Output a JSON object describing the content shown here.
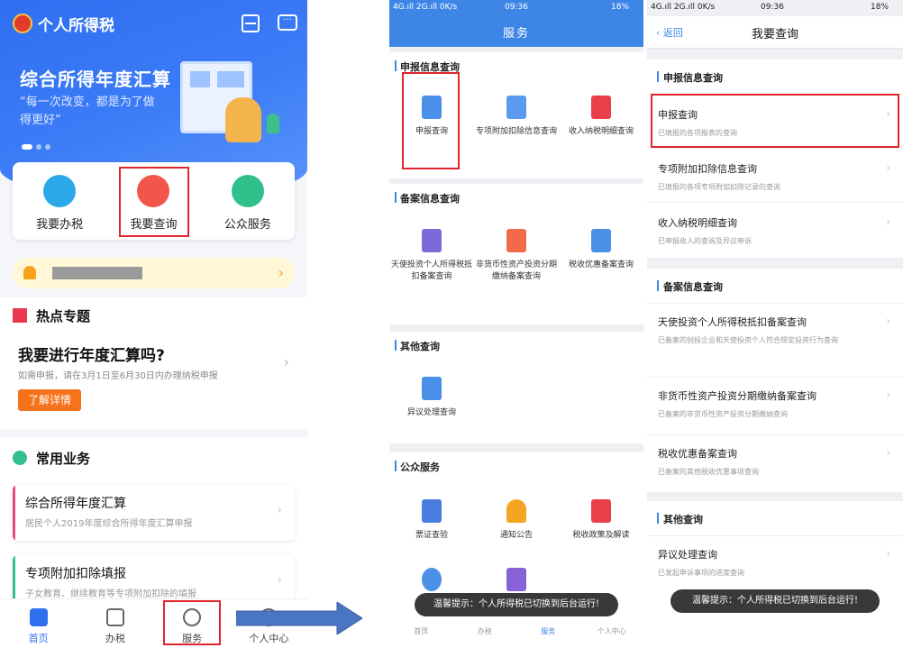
{
  "panel1": {
    "app_title": "个人所得税",
    "banner": {
      "title": "综合所得年度汇算",
      "subtitle": "“每一次改变，都是为了做得更好”"
    },
    "quick": [
      {
        "label": "我要办税",
        "color": "#2aa8e8"
      },
      {
        "label": "我要查询",
        "color": "#f2564a"
      },
      {
        "label": "公众服务",
        "color": "#2fc08c"
      }
    ],
    "hot": {
      "title": "热点专题",
      "headline": "我要进行年度汇算吗?",
      "desc": "如需申报，请在3月1日至6月30日内办理纳税申报",
      "button": "了解详情"
    },
    "common": {
      "title": "常用业务",
      "cards": [
        {
          "title": "综合所得年度汇算",
          "sub": "居民个人2019年度综合所得年度汇算申报",
          "color": "#e8487c"
        },
        {
          "title": "专项附加扣除填报",
          "sub": "子女教育、继续教育等专项附加扣除的填报",
          "color": "#2fc08c"
        }
      ]
    },
    "tabs": [
      "首页",
      "办税",
      "服务",
      "个人中心"
    ]
  },
  "status": {
    "left": "4G.ıll 2G.ıll 0K/s",
    "time": "09:36",
    "right": "18%"
  },
  "panel2": {
    "title": "服务",
    "sections": [
      {
        "title": "申报信息查询",
        "items": [
          "申报查询",
          "专项附加扣除信息查询",
          "收入纳税明细查询"
        ]
      },
      {
        "title": "备案信息查询",
        "items": [
          "天使投资个人所得税抵扣备案查询",
          "非货币性资产投资分期缴纳备案查询",
          "税收优惠备案查询"
        ]
      },
      {
        "title": "其他查询",
        "items": [
          "异议处理查询"
        ]
      },
      {
        "title": "公众服务",
        "items": [
          "票证查验",
          "通知公告",
          "税收政策及解读"
        ]
      }
    ],
    "toast": "温馨提示：个人所得税已切换到后台运行!",
    "bottom_tabs": [
      "首页",
      "办税",
      "服务",
      "个人中心"
    ]
  },
  "panel3": {
    "back": "返回",
    "title": "我要查询",
    "groups": [
      {
        "title": "申报信息查询",
        "rows": [
          {
            "title": "申报查询",
            "sub": "已填报的各项报表的查询"
          },
          {
            "title": "专项附加扣除信息查询",
            "sub": "已填报的各项专项附加扣除记录的查询"
          },
          {
            "title": "收入纳税明细查询",
            "sub": "已申报收入的查询及异议申诉"
          }
        ]
      },
      {
        "title": "备案信息查询",
        "rows": [
          {
            "title": "天使投资个人所得税抵扣备案查询",
            "sub": "已备案的创投企业和天使投资个人符合规定投资行为查询"
          },
          {
            "title": "非货币性资产投资分期缴纳备案查询",
            "sub": "已备案的非货币性资产投资分期缴纳查询"
          },
          {
            "title": "税收优惠备案查询",
            "sub": "已备案的其他税收优惠事项查询"
          }
        ]
      },
      {
        "title": "其他查询",
        "rows": [
          {
            "title": "异议处理查询",
            "sub": "已发起申诉事项的进度查询"
          }
        ]
      }
    ],
    "toast": "温馨提示：个人所得税已切换到后台运行!"
  },
  "colors": {
    "brand_blue": "#2f6ff0",
    "highlight_red": "#e0262c",
    "orange": "#f6731c"
  },
  "icons": [
    "emblem-icon",
    "scan-icon",
    "message-icon",
    "bell-icon",
    "chevron-right-icon",
    "ribbon-icon",
    "clover-icon",
    "arrow-right-icon"
  ]
}
